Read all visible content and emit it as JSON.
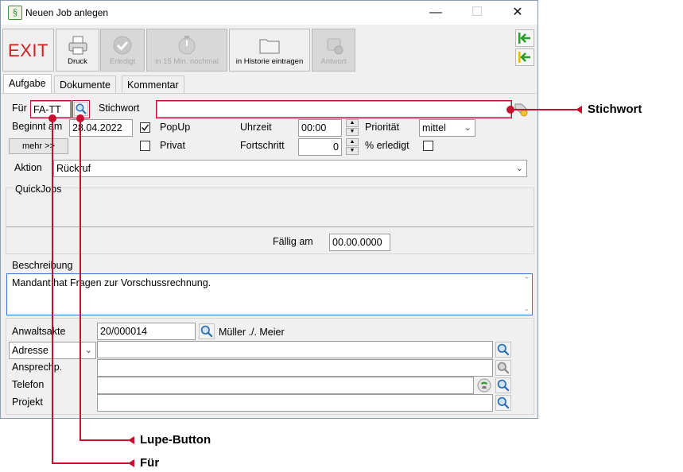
{
  "window": {
    "title": "Neuen Job anlegen",
    "app_icon_glyph": "§",
    "controls": {
      "minimize": "—",
      "maximize": "☐",
      "close": "✕"
    }
  },
  "toolbar": {
    "exit_label": "EXIT",
    "print_label": "Druck",
    "done_label": "Erledigt",
    "snooze_label": "in 15 Min. nochmal",
    "history_label": "in Historie eintragen",
    "reply_label": "Antwort"
  },
  "tabs": [
    "Aufgabe",
    "Dokumente",
    "Kommentar"
  ],
  "form": {
    "fuer_label": "Für",
    "fuer_value": "FA-TT",
    "stichwort_label": "Stichwort",
    "stichwort_value": "",
    "beginnt_label": "Beginnt am",
    "beginnt_value": "28.04.2022",
    "popup_label": "PopUp",
    "popup_checked": true,
    "privat_label": "Privat",
    "privat_checked": false,
    "mehr_label": "mehr >>",
    "uhrzeit_label": "Uhrzeit",
    "uhrzeit_value": "00:00",
    "fortschritt_label": "Fortschritt",
    "fortschritt_value": "0",
    "prioritaet_label": "Priorität",
    "prioritaet_value": "mittel",
    "erledigt_label": "% erledigt",
    "erledigt_checked": false,
    "aktion_label": "Aktion",
    "aktion_value": "Rückruf",
    "quickjobs_label": "QuickJobs",
    "faellig_label": "Fällig am",
    "faellig_value": "00.00.0000",
    "beschreibung_label": "Beschreibung",
    "beschreibung_value": "Mandant hat Fragen zur Vorschussrechnung.",
    "anwaltsakte_label": "Anwaltsakte",
    "anwaltsakte_value": "20/000014",
    "anwaltsakte_name": "Müller ./. Meier",
    "adresse_label": "Adresse",
    "ansprechp_label": "Ansprechp.",
    "telefon_label": "Telefon",
    "projekt_label": "Projekt"
  },
  "callouts": {
    "stichwort": "Stichwort",
    "lupe": "Lupe-Button",
    "fuer": "Für"
  },
  "colors": {
    "accent_red": "#c8102e",
    "exit_red": "#d0201f",
    "nav_green": "#2e9b2e",
    "focus_blue": "#3a7bd5"
  }
}
